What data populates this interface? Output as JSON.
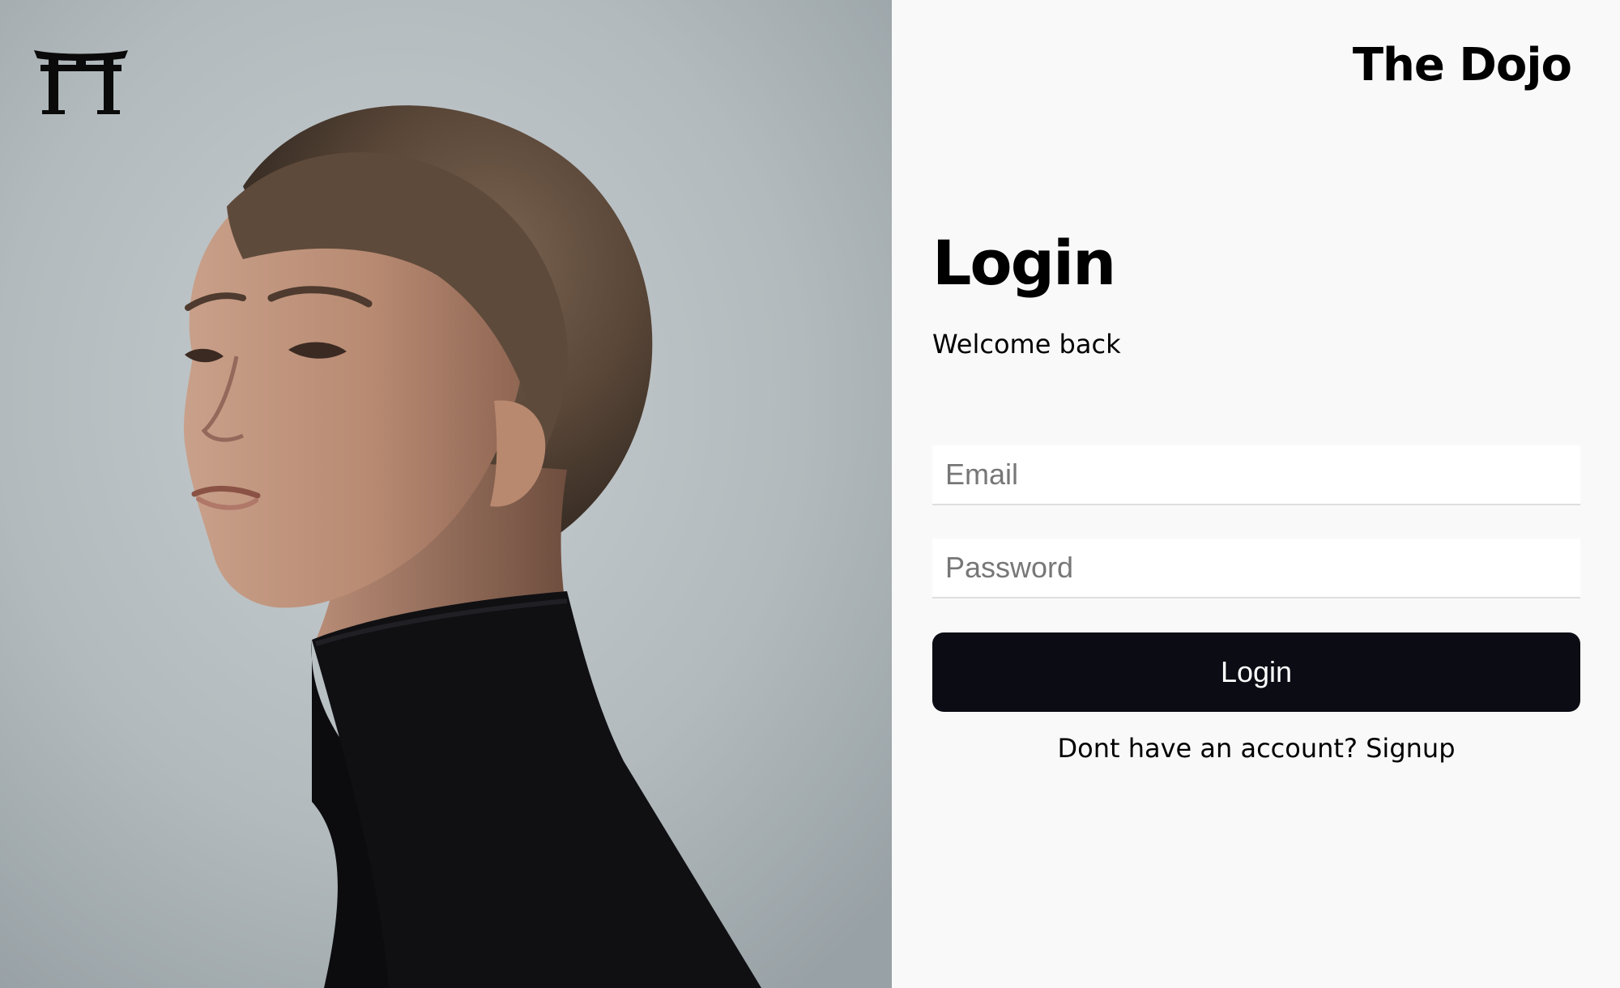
{
  "brand": {
    "name": "The Dojo",
    "logo_icon": "torii-gate-icon"
  },
  "hero": {
    "image": "portrait-photo"
  },
  "login": {
    "title": "Login",
    "subtitle": "Welcome back",
    "email_placeholder": "Email",
    "password_placeholder": "Password",
    "submit_label": "Login",
    "signup_prompt": "Dont have an account? ",
    "signup_link": "Signup"
  },
  "colors": {
    "button_bg": "#0b0c14",
    "panel_bg": "#f9f9f9",
    "field_bg": "#ffffff"
  }
}
